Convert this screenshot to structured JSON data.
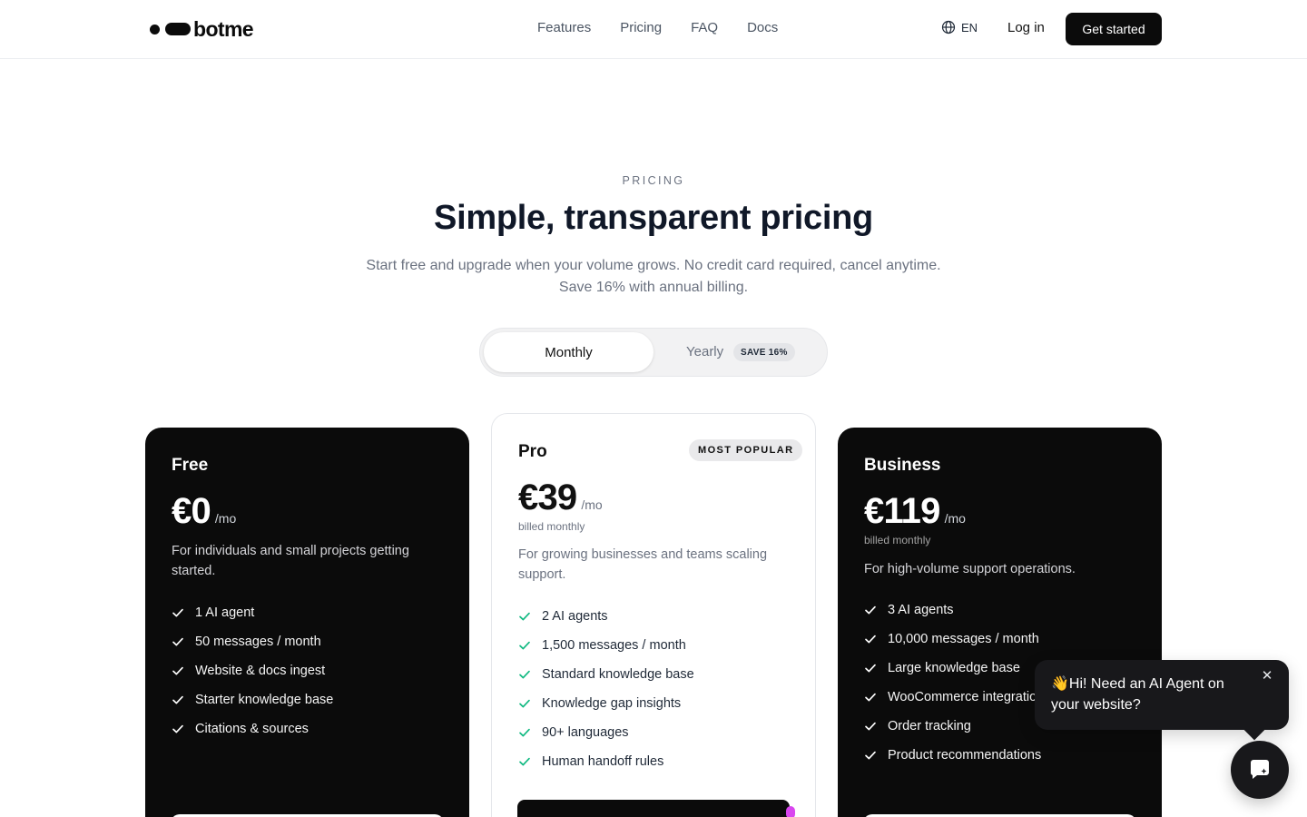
{
  "brand": {
    "logo_text": "botme"
  },
  "nav": {
    "items": [
      "Features",
      "Pricing",
      "FAQ",
      "Docs"
    ]
  },
  "header": {
    "language": "EN",
    "login_label": "Log in",
    "cta_label": "Get started"
  },
  "hero": {
    "eyebrow": "PRICING",
    "title": "Simple, transparent pricing",
    "subtitle_line1": "Start free and upgrade when your volume grows. No credit card required, cancel anytime.",
    "subtitle_line2": "Save 16% with annual billing."
  },
  "billing_toggle": {
    "monthly_label": "Monthly",
    "yearly_label": "Yearly",
    "yearly_badge": "SAVE 16%",
    "selected": "Monthly"
  },
  "plans": [
    {
      "name": "Free",
      "price": "€0",
      "period": "/mo",
      "billed": "",
      "description": "For individuals and small projects getting started.",
      "features": [
        "1 AI agent",
        "50 messages / month",
        "Website & docs ingest",
        "Starter knowledge base",
        "Citations & sources"
      ]
    },
    {
      "name": "Pro",
      "badge": "MOST POPULAR",
      "price": "€39",
      "period": "/mo",
      "billed": "billed monthly",
      "description": "For growing businesses and teams scaling support.",
      "features": [
        "2 AI agents",
        "1,500 messages / month",
        "Standard knowledge base",
        "Knowledge gap insights",
        "90+ languages",
        "Human handoff rules"
      ]
    },
    {
      "name": "Business",
      "price": "€119",
      "period": "/mo",
      "billed": "billed monthly",
      "description": "For high-volume support operations.",
      "features": [
        "3 AI agents",
        "10,000 messages / month",
        "Large knowledge base",
        "WooCommerce integration",
        "Order tracking",
        "Product recommendations"
      ]
    }
  ],
  "chat_widget": {
    "message": "👋Hi! Need an AI Agent on your website?",
    "close_symbol": "✕"
  },
  "colors": {
    "dark_card": "#0b0b0b",
    "check_green": "#10b981",
    "accent_glow": "#d946ef"
  },
  "icons": [
    "globe-icon",
    "check-icon",
    "close-icon",
    "chat-icon"
  ]
}
